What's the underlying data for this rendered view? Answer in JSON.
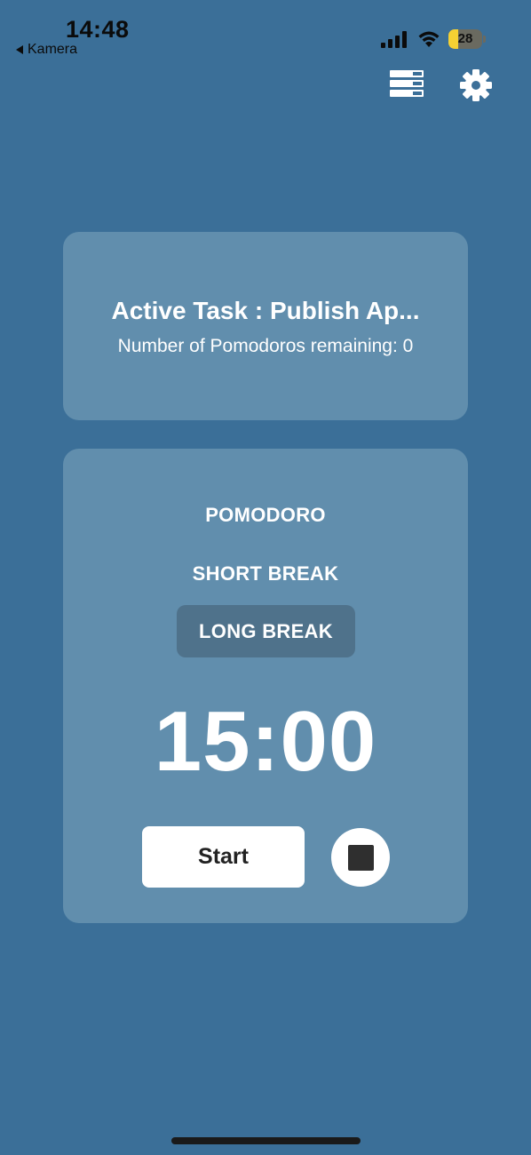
{
  "status_bar": {
    "time": "14:48",
    "back_label": "Kamera",
    "battery_level": "28",
    "battery_fraction": 0.28,
    "icons": [
      "signal-icon",
      "wifi-icon",
      "battery-icon"
    ]
  },
  "header": {
    "icons": [
      "task-list-icon",
      "settings-gear-icon"
    ]
  },
  "task": {
    "title": "Active Task : Publish Ap...",
    "remaining": "Number of Pomodoros remaining: 0"
  },
  "modes": {
    "pomodoro": "POMODORO",
    "short_break": "SHORT BREAK",
    "long_break": "LONG BREAK",
    "selected": "long_break"
  },
  "timer": {
    "display": "15:00"
  },
  "controls": {
    "start_label": "Start",
    "stop_icon": "stop-icon"
  },
  "colors": {
    "background": "#3b6f98",
    "card": "#618ead",
    "selected_mode": "#4f728b",
    "battery": "#f5d133"
  }
}
